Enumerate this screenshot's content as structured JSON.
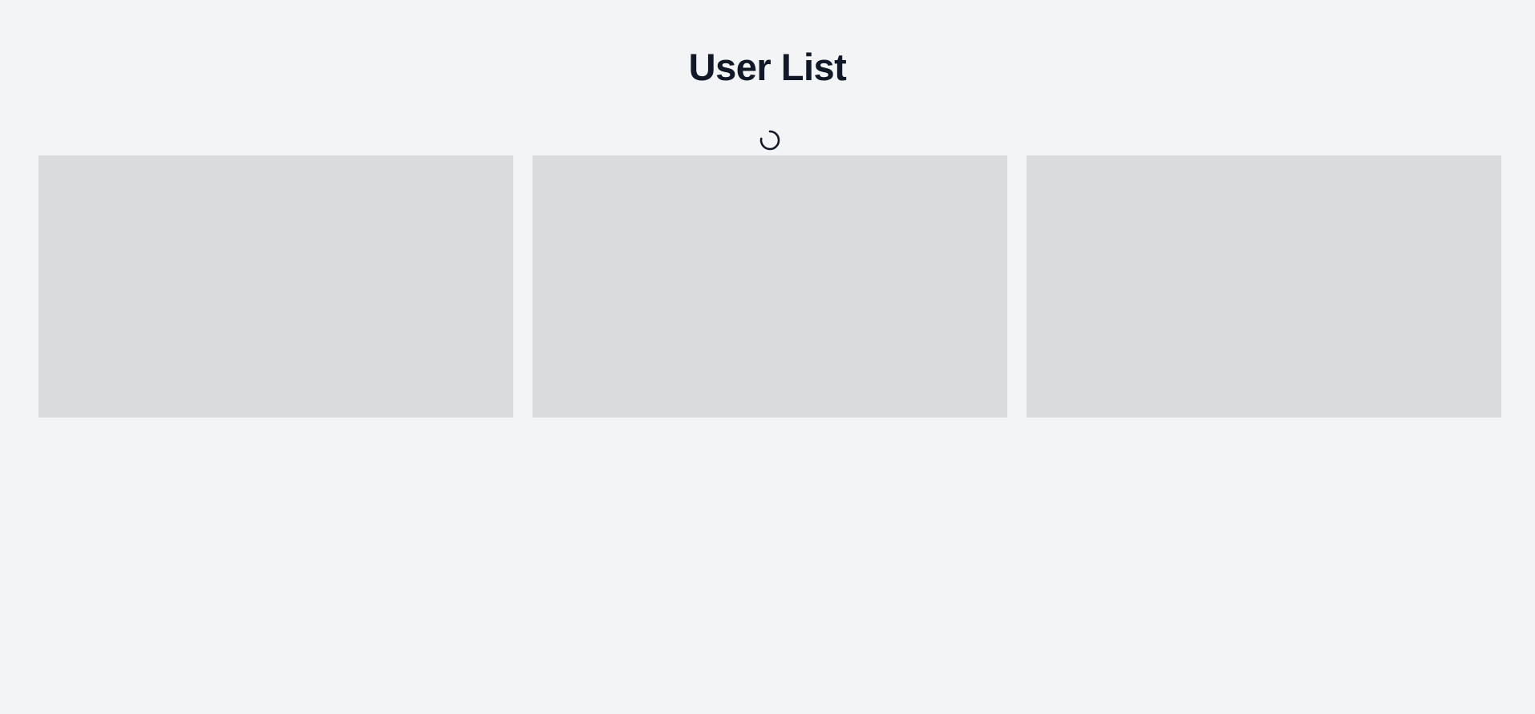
{
  "page": {
    "title": "User List"
  },
  "loading": {
    "icon": "spinner-icon",
    "active": true
  },
  "user_cards": {
    "placeholder_count": 3,
    "items": [
      {
        "state": "loading"
      },
      {
        "state": "loading"
      },
      {
        "state": "loading"
      }
    ]
  },
  "colors": {
    "background": "#f3f4f6",
    "title_text": "#111827",
    "skeleton": "#dadbdd",
    "spinner": "#111827"
  }
}
